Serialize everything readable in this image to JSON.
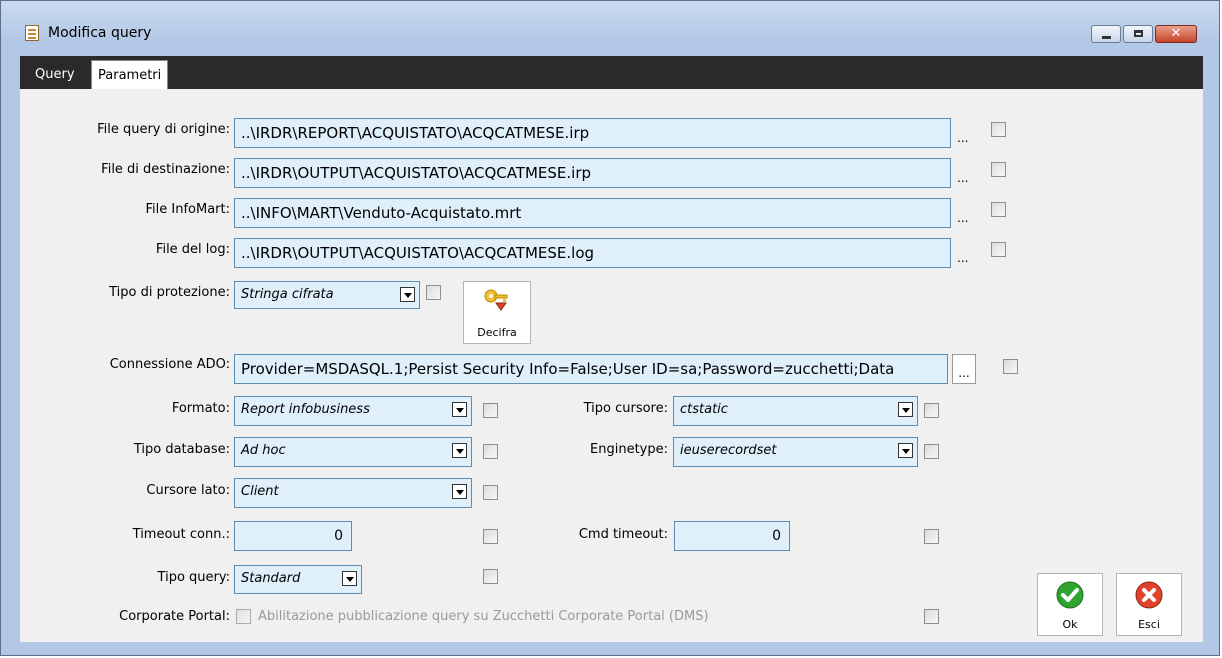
{
  "window": {
    "title": "Modifica query",
    "close_glyph": "✕"
  },
  "tabs": [
    {
      "label": "Query"
    },
    {
      "label": "Parametri"
    }
  ],
  "files": {
    "origin_label": "File query di origine:",
    "origin_value": "..\\IRDR\\REPORT\\ACQUISTATO\\ACQCATMESE.irp",
    "dest_label": "File di destinazione:",
    "dest_value": "..\\IRDR\\OUTPUT\\ACQUISTATO\\ACQCATMESE.irp",
    "infomart_label": "File InfoMart:",
    "infomart_value": "..\\INFO\\MART\\Venduto-Acquistato.mrt",
    "log_label": "File del log:",
    "log_value": "..\\IRDR\\OUTPUT\\ACQUISTATO\\ACQCATMESE.log",
    "ellipsis": "..."
  },
  "protection": {
    "label": "Tipo di protezione:",
    "value": "Stringa cifrata",
    "decifra_label": "Decifra"
  },
  "ado": {
    "label": "Connessione ADO:",
    "value": "Provider=MSDASQL.1;Persist Security Info=False;User ID=sa;Password=zucchetti;Data"
  },
  "formato": {
    "label": "Formato:",
    "value": "Report infobusiness"
  },
  "tipo_database": {
    "label": "Tipo database:",
    "value": "Ad hoc"
  },
  "cursore_lato": {
    "label": "Cursore lato:",
    "value": "Client"
  },
  "tipo_cursore": {
    "label": "Tipo cursore:",
    "value": "ctstatic"
  },
  "enginetype": {
    "label": "Enginetype:",
    "value": "ieuserecordset"
  },
  "timeout_conn": {
    "label": "Timeout conn.:",
    "value": "0"
  },
  "cmd_timeout": {
    "label": "Cmd timeout:",
    "value": "0"
  },
  "tipo_query": {
    "label": "Tipo query:",
    "value": "Standard"
  },
  "corporate_portal": {
    "label": "Corporate Portal:",
    "text": "Abilitazione pubblicazione query su Zucchetti Corporate Portal (DMS)"
  },
  "buttons": {
    "ok": "Ok",
    "esci": "Esci"
  }
}
